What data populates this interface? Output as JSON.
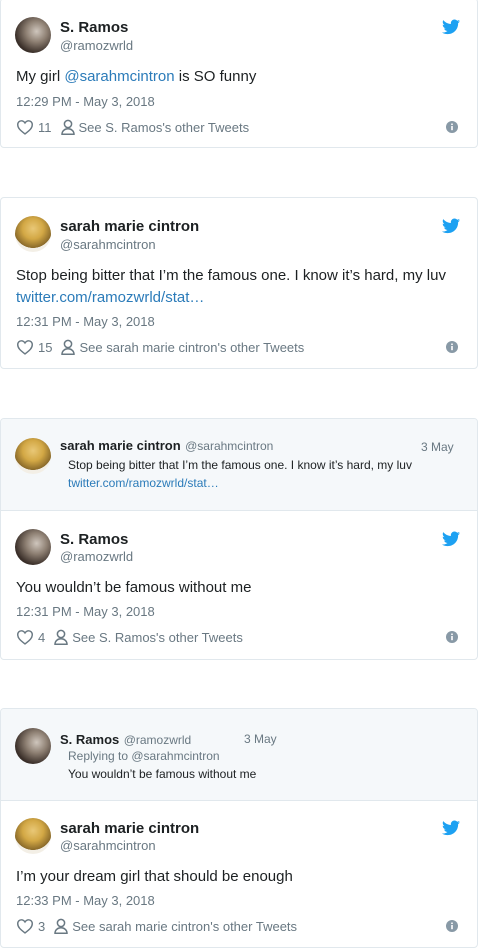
{
  "tweets": [
    {
      "name": "S. Ramos",
      "handle": "@ramozwrld",
      "text_prefix": "My girl ",
      "mention": "@sarahmcintron",
      "text_suffix": " is SO funny",
      "time": "12:29 PM - May 3, 2018",
      "likes": "11",
      "other_tweets": "See S. Ramos's other Tweets"
    },
    {
      "name": "sarah marie cintron",
      "handle": "@sarahmcintron",
      "text": "Stop being bitter that I’m the famous one. I know it’s hard, my luv ",
      "link": "twitter.com/ramozwrld/stat…",
      "time": "12:31 PM - May 3, 2018",
      "likes": "15",
      "other_tweets": "See sarah marie cintron's other Tweets"
    },
    {
      "quoted": {
        "name": "sarah marie cintron",
        "handle": "@sarahmcintron",
        "date": "3 May",
        "text": "Stop being bitter that I’m the famous one. I know it’s hard, my luv",
        "link": "twitter.com/ramozwrld/stat…"
      },
      "name": "S. Ramos",
      "handle": "@ramozwrld",
      "text": "You wouldn’t be famous without me",
      "time": "12:31 PM - May 3, 2018",
      "likes": "4",
      "other_tweets": "See S. Ramos's other Tweets"
    },
    {
      "quoted": {
        "name": "S. Ramos",
        "handle": "@ramozwrld",
        "date": "3 May",
        "reply_to": "Replying to @sarahmcintron",
        "text": "You wouldn’t be famous without me"
      },
      "name": "sarah marie cintron",
      "handle": "@sarahmcintron",
      "text": "I’m your dream girl that should be enough",
      "time": "12:33 PM - May 3, 2018",
      "likes": "3",
      "other_tweets": "See sarah marie cintron's other Tweets"
    }
  ],
  "colors": {
    "twitter_blue": "#1da1f2",
    "link": "#2b7bb9",
    "muted": "#697882",
    "border": "#e1e8ed"
  },
  "icons": {
    "logo": "twitter-bird-icon",
    "like": "heart-icon",
    "profile": "person-icon",
    "info": "info-icon"
  }
}
